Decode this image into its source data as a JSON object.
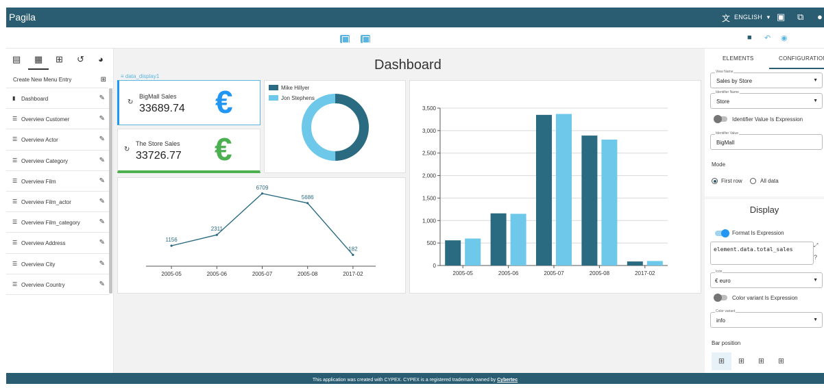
{
  "header": {
    "app_title": "Pagila",
    "language": "ENGLISH",
    "language_caret": "▾",
    "lang_icon": "translate-icon",
    "icons": [
      "layout-icon",
      "page-icon",
      "account-icon"
    ]
  },
  "toolbar": {
    "icons": [
      "desktop-view-icon",
      "mobile-view-icon",
      "save-icon",
      "undo-icon",
      "preview-icon"
    ]
  },
  "sidebar": {
    "create_entry": "Create New Menu Entry",
    "items": [
      {
        "icon": "bar-chart-icon",
        "label": "Dashboard"
      },
      {
        "icon": "list-icon",
        "label": "Overview Customer"
      },
      {
        "icon": "list-icon",
        "label": "Overview Actor"
      },
      {
        "icon": "list-icon",
        "label": "Overview Category"
      },
      {
        "icon": "list-icon",
        "label": "Overview Film"
      },
      {
        "icon": "list-icon",
        "label": "Overview Film_actor"
      },
      {
        "icon": "list-icon",
        "label": "Overview Film_category"
      },
      {
        "icon": "list-icon",
        "label": "Overview Address"
      },
      {
        "icon": "list-icon",
        "label": "Overview City"
      },
      {
        "icon": "list-icon",
        "label": "Overview Country"
      }
    ]
  },
  "main": {
    "title": "Dashboard",
    "data_display_label": "data_display1",
    "kpi1": {
      "title": "BigMall Sales",
      "value": "33689.74",
      "icon": "€",
      "color": "#2196f3"
    },
    "kpi2": {
      "title": "The Store Sales",
      "value": "33726.77",
      "icon": "€",
      "color": "#4caf50"
    }
  },
  "colors": {
    "dark": "#2a6b82",
    "light": "#6dc8ea"
  },
  "chart_data": [
    {
      "type": "pie",
      "legend": [
        "Mike Hillyer",
        "Jon Stephens"
      ],
      "values": [
        33689.74,
        33726.77
      ],
      "legend_position": "top-left"
    },
    {
      "type": "line",
      "x": [
        "2005-05",
        "2005-06",
        "2005-07",
        "2005-08",
        "2017-02"
      ],
      "values": [
        1156,
        2311,
        6709,
        5686,
        182
      ],
      "labels": [
        "1156",
        "2311",
        "6709",
        "5686",
        "182"
      ]
    },
    {
      "type": "bar",
      "categories": [
        "2005-05",
        "2005-06",
        "2005-07",
        "2005-08",
        "2017-02"
      ],
      "series": [
        {
          "values": [
            560,
            1160,
            3350,
            2890,
            90
          ]
        },
        {
          "values": [
            600,
            1150,
            3370,
            2800,
            100
          ]
        }
      ],
      "yticks": [
        "0",
        "500",
        "1,000",
        "1,500",
        "2,000",
        "2,500",
        "3,000",
        "3,500"
      ],
      "ylim": [
        0,
        3500
      ],
      "grid": true
    }
  ],
  "config": {
    "tabs": [
      "ELEMENTS",
      "CONFIGURATION"
    ],
    "view_name_label": "View Name",
    "view_name": "Sales by Store",
    "identifier_name_label": "Identifier Name",
    "identifier_name": "Store",
    "identifier_expr_label": "Identifier Value Is Expression",
    "identifier_value_label": "Identifier Value",
    "identifier_value": "BigMall",
    "mode_label": "Mode",
    "mode_first": "First row",
    "mode_all": "All data",
    "display_title": "Display",
    "format_expr_label": "Format Is Expression",
    "format_value": "element.data.total_sales",
    "icon_label": "Icon",
    "icon_value": "€ euro",
    "color_expr_label": "Color variant Is Expression",
    "color_variant_label": "Color variant",
    "color_variant": "info",
    "bar_position_label": "Bar position"
  },
  "footer": {
    "text": "This application was created with CYPEX. CYPEX is a registered trademark owned by ",
    "owner": "Cybertec"
  }
}
